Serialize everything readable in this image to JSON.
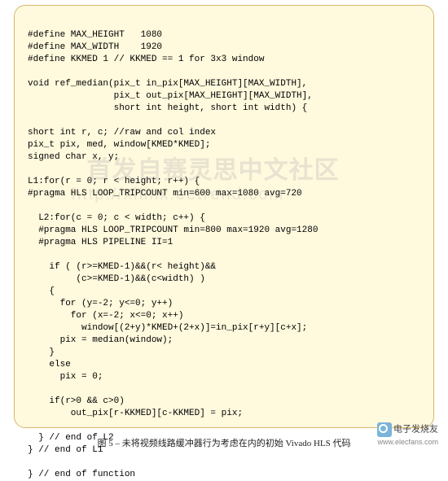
{
  "code": {
    "define1": "#define MAX_HEIGHT   1080",
    "define2": "#define MAX_WIDTH    1920",
    "define3": "#define KKMED 1 // KKMED == 1 for 3x3 window",
    "fn1": "void ref_median(pix_t in_pix[MAX_HEIGHT][MAX_WIDTH],",
    "fn2": "                pix_t out_pix[MAX_HEIGHT][MAX_WIDTH],",
    "fn3": "                short int height, short int width) {",
    "decl1": "short int r, c; //raw and col index",
    "decl2": "pix_t pix, med, window[KMED*KMED];",
    "decl3": "signed char x, y;",
    "L1": "L1:for(r = 0; r < height; r++) {",
    "prag1": "#pragma HLS LOOP_TRIPCOUNT min=600 max=1080 avg=720",
    "L2": "  L2:for(c = 0; c < width; c++) {",
    "prag2": "  #pragma HLS LOOP_TRIPCOUNT min=800 max=1920 avg=1280",
    "prag3": "  #pragma HLS PIPELINE II=1",
    "if1": "    if ( (r>=KMED-1)&&(r< height)&&",
    "if2": "         (c>=KMED-1)&&(c<width) )",
    "br1": "    {",
    "for1": "      for (y=-2; y<=0; y++)",
    "for2": "        for (x=-2; x<=0; x++)",
    "win": "          window[(2+y)*KMED+(2+x)]=in_pix[r+y][c+x];",
    "med": "      pix = median(window);",
    "br2": "    }",
    "else": "    else",
    "pix0": "      pix = 0;",
    "if3": "    if(r>0 && c>0)",
    "out": "        out_pix[r-KKMED][c-KKMED] = pix;",
    "endL2": "  } // end of L2",
    "endL1": "} // end of L1",
    "endFn": "} // end of function"
  },
  "watermark": {
    "main": "首发自赛灵思中文社区",
    "sub": "http://xilinx.eetrend.com"
  },
  "caption": "图 5 – 未将视频线路缓冲器行为考虑在内的初始 Vivado HLS 代码",
  "footer": {
    "cn": "电子发烧友",
    "url": "www.elecfans.com"
  }
}
